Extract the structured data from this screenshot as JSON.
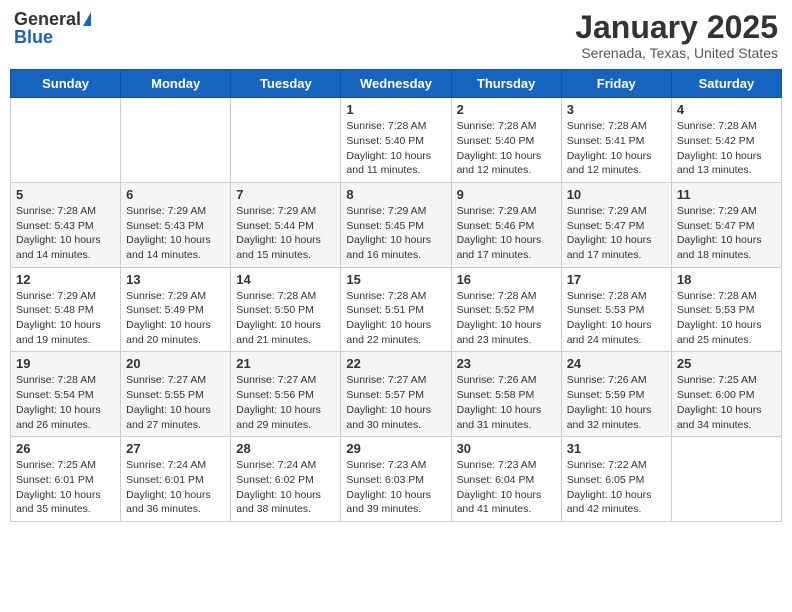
{
  "header": {
    "logo_general": "General",
    "logo_blue": "Blue",
    "month_title": "January 2025",
    "location": "Serenada, Texas, United States"
  },
  "weekdays": [
    "Sunday",
    "Monday",
    "Tuesday",
    "Wednesday",
    "Thursday",
    "Friday",
    "Saturday"
  ],
  "weeks": [
    [
      {
        "date": "",
        "info": ""
      },
      {
        "date": "",
        "info": ""
      },
      {
        "date": "",
        "info": ""
      },
      {
        "date": "1",
        "info": "Sunrise: 7:28 AM\nSunset: 5:40 PM\nDaylight: 10 hours\nand 11 minutes."
      },
      {
        "date": "2",
        "info": "Sunrise: 7:28 AM\nSunset: 5:40 PM\nDaylight: 10 hours\nand 12 minutes."
      },
      {
        "date": "3",
        "info": "Sunrise: 7:28 AM\nSunset: 5:41 PM\nDaylight: 10 hours\nand 12 minutes."
      },
      {
        "date": "4",
        "info": "Sunrise: 7:28 AM\nSunset: 5:42 PM\nDaylight: 10 hours\nand 13 minutes."
      }
    ],
    [
      {
        "date": "5",
        "info": "Sunrise: 7:28 AM\nSunset: 5:43 PM\nDaylight: 10 hours\nand 14 minutes."
      },
      {
        "date": "6",
        "info": "Sunrise: 7:29 AM\nSunset: 5:43 PM\nDaylight: 10 hours\nand 14 minutes."
      },
      {
        "date": "7",
        "info": "Sunrise: 7:29 AM\nSunset: 5:44 PM\nDaylight: 10 hours\nand 15 minutes."
      },
      {
        "date": "8",
        "info": "Sunrise: 7:29 AM\nSunset: 5:45 PM\nDaylight: 10 hours\nand 16 minutes."
      },
      {
        "date": "9",
        "info": "Sunrise: 7:29 AM\nSunset: 5:46 PM\nDaylight: 10 hours\nand 17 minutes."
      },
      {
        "date": "10",
        "info": "Sunrise: 7:29 AM\nSunset: 5:47 PM\nDaylight: 10 hours\nand 17 minutes."
      },
      {
        "date": "11",
        "info": "Sunrise: 7:29 AM\nSunset: 5:47 PM\nDaylight: 10 hours\nand 18 minutes."
      }
    ],
    [
      {
        "date": "12",
        "info": "Sunrise: 7:29 AM\nSunset: 5:48 PM\nDaylight: 10 hours\nand 19 minutes."
      },
      {
        "date": "13",
        "info": "Sunrise: 7:29 AM\nSunset: 5:49 PM\nDaylight: 10 hours\nand 20 minutes."
      },
      {
        "date": "14",
        "info": "Sunrise: 7:28 AM\nSunset: 5:50 PM\nDaylight: 10 hours\nand 21 minutes."
      },
      {
        "date": "15",
        "info": "Sunrise: 7:28 AM\nSunset: 5:51 PM\nDaylight: 10 hours\nand 22 minutes."
      },
      {
        "date": "16",
        "info": "Sunrise: 7:28 AM\nSunset: 5:52 PM\nDaylight: 10 hours\nand 23 minutes."
      },
      {
        "date": "17",
        "info": "Sunrise: 7:28 AM\nSunset: 5:53 PM\nDaylight: 10 hours\nand 24 minutes."
      },
      {
        "date": "18",
        "info": "Sunrise: 7:28 AM\nSunset: 5:53 PM\nDaylight: 10 hours\nand 25 minutes."
      }
    ],
    [
      {
        "date": "19",
        "info": "Sunrise: 7:28 AM\nSunset: 5:54 PM\nDaylight: 10 hours\nand 26 minutes."
      },
      {
        "date": "20",
        "info": "Sunrise: 7:27 AM\nSunset: 5:55 PM\nDaylight: 10 hours\nand 27 minutes."
      },
      {
        "date": "21",
        "info": "Sunrise: 7:27 AM\nSunset: 5:56 PM\nDaylight: 10 hours\nand 29 minutes."
      },
      {
        "date": "22",
        "info": "Sunrise: 7:27 AM\nSunset: 5:57 PM\nDaylight: 10 hours\nand 30 minutes."
      },
      {
        "date": "23",
        "info": "Sunrise: 7:26 AM\nSunset: 5:58 PM\nDaylight: 10 hours\nand 31 minutes."
      },
      {
        "date": "24",
        "info": "Sunrise: 7:26 AM\nSunset: 5:59 PM\nDaylight: 10 hours\nand 32 minutes."
      },
      {
        "date": "25",
        "info": "Sunrise: 7:25 AM\nSunset: 6:00 PM\nDaylight: 10 hours\nand 34 minutes."
      }
    ],
    [
      {
        "date": "26",
        "info": "Sunrise: 7:25 AM\nSunset: 6:01 PM\nDaylight: 10 hours\nand 35 minutes."
      },
      {
        "date": "27",
        "info": "Sunrise: 7:24 AM\nSunset: 6:01 PM\nDaylight: 10 hours\nand 36 minutes."
      },
      {
        "date": "28",
        "info": "Sunrise: 7:24 AM\nSunset: 6:02 PM\nDaylight: 10 hours\nand 38 minutes."
      },
      {
        "date": "29",
        "info": "Sunrise: 7:23 AM\nSunset: 6:03 PM\nDaylight: 10 hours\nand 39 minutes."
      },
      {
        "date": "30",
        "info": "Sunrise: 7:23 AM\nSunset: 6:04 PM\nDaylight: 10 hours\nand 41 minutes."
      },
      {
        "date": "31",
        "info": "Sunrise: 7:22 AM\nSunset: 6:05 PM\nDaylight: 10 hours\nand 42 minutes."
      },
      {
        "date": "",
        "info": ""
      }
    ]
  ]
}
